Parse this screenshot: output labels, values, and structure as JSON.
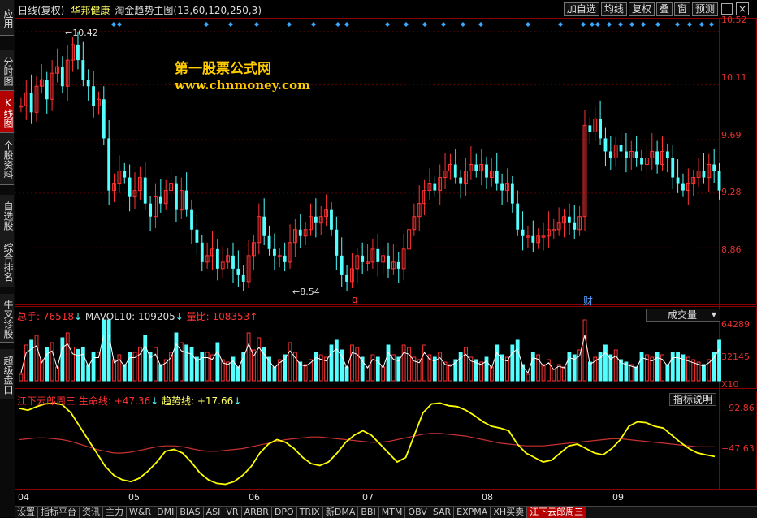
{
  "sidebar": {
    "tabs": [
      {
        "label": "应用",
        "active": false
      },
      {
        "label": "分时图",
        "active": false
      },
      {
        "label": "K线图",
        "active": true
      },
      {
        "label": "个股资料",
        "active": false
      },
      {
        "label": "自选股",
        "active": false
      },
      {
        "label": "综合排名",
        "active": false
      },
      {
        "label": "牛叉诊股",
        "active": false
      },
      {
        "label": "超级盘口",
        "active": false
      }
    ]
  },
  "header": {
    "period": "日线(复权)",
    "stock_name": "华邦健康",
    "indicator": "淘金趋势主图(13,60,120,250,3)",
    "buttons": [
      "加自选",
      "均线",
      "复权",
      "叠",
      "窗",
      "预测"
    ],
    "close_glyph": "×"
  },
  "watermark": {
    "line1": "第一股票公式网",
    "line2": "www.chnmoney.com"
  },
  "main_chart": {
    "price_scale": [
      "10.52",
      "10.11",
      "9.69",
      "9.28",
      "8.86"
    ],
    "high_label": "10.42",
    "low_label": "8.54",
    "markers": [
      "q",
      "财"
    ],
    "month_labels": [
      "04",
      "05",
      "06",
      "07",
      "08",
      "09"
    ]
  },
  "volume_panel": {
    "legend_total": "总手: 76518",
    "legend_mavol": "MAVOL10: 109205",
    "legend_ratio": "量比: 108353",
    "scale": [
      "64289",
      "32145",
      "X10"
    ],
    "dropdown_label": "成交量"
  },
  "indicator_panel": {
    "legend_name": "江下云郎周三",
    "legend_life": "生命线: +47.36",
    "legend_trend": "趋势线: +17.66",
    "scale": [
      "+92.86",
      "+47.63"
    ],
    "help_button": "指标说明"
  },
  "bottom_tabs": [
    "设置",
    "指标平台",
    "资讯",
    "主力",
    "W&R",
    "DMI",
    "BIAS",
    "ASI",
    "VR",
    "ARBR",
    "DPO",
    "TRIX",
    "新DMA",
    "BBI",
    "MTM",
    "OBV",
    "SAR",
    "EXPMA",
    "XH买卖",
    "江下云郎周三"
  ],
  "active_bottom_tab": "江下云郎周三",
  "colors": {
    "up": "#ff3232",
    "down": "#54ffff",
    "yellow": "#ffff00",
    "lifeline": "#c83232",
    "accent": "#b40000"
  },
  "chart_data": {
    "type": "candlestick",
    "price_axis": {
      "ticks": [
        10.52,
        10.11,
        9.69,
        9.28,
        8.86
      ],
      "range": [
        8.45,
        10.6
      ]
    },
    "high": 10.42,
    "low": 8.54,
    "candles_close": [
      9.95,
      10.05,
      9.9,
      10.1,
      10.15,
      10.0,
      10.2,
      10.25,
      10.1,
      10.3,
      10.42,
      10.3,
      10.15,
      10.1,
      9.95,
      10.0,
      9.7,
      9.3,
      9.35,
      9.45,
      9.4,
      9.25,
      9.3,
      9.4,
      9.2,
      9.1,
      9.25,
      9.2,
      9.3,
      9.35,
      9.15,
      9.3,
      9.15,
      9.0,
      8.9,
      8.75,
      8.8,
      8.85,
      8.7,
      8.75,
      8.8,
      8.7,
      8.65,
      8.6,
      8.8,
      8.9,
      9.1,
      8.95,
      8.85,
      8.8,
      8.8,
      8.75,
      8.9,
      9.0,
      8.95,
      9.0,
      9.1,
      9.05,
      9.1,
      9.15,
      9.0,
      8.8,
      8.65,
      8.6,
      8.7,
      8.8,
      8.75,
      8.75,
      8.85,
      8.75,
      8.8,
      8.7,
      8.75,
      8.7,
      8.85,
      9.0,
      9.1,
      9.2,
      9.3,
      9.35,
      9.3,
      9.4,
      9.45,
      9.5,
      9.4,
      9.35,
      9.45,
      9.5,
      9.45,
      9.5,
      9.4,
      9.45,
      9.35,
      9.3,
      9.35,
      9.2,
      9.0,
      8.95,
      8.95,
      8.9,
      8.95,
      8.95,
      9.0,
      9.0,
      9.05,
      9.1,
      9.05,
      9.0,
      9.1,
      9.8,
      9.75,
      9.85,
      9.7,
      9.6,
      9.55,
      9.65,
      9.6,
      9.55,
      9.6,
      9.55,
      9.5,
      9.55,
      9.6,
      9.5,
      9.6,
      9.55,
      9.4,
      9.35,
      9.3,
      9.35,
      9.4,
      9.45,
      9.4,
      9.5,
      9.45,
      9.3
    ],
    "volume_axis": {
      "ticks": [
        64289,
        32145
      ],
      "unit": "X10"
    },
    "indicator_axis": {
      "ticks": [
        92.86,
        47.63
      ]
    },
    "trend_line": [
      90,
      88,
      92,
      95,
      96,
      94,
      85,
      70,
      55,
      40,
      25,
      15,
      10,
      8,
      12,
      20,
      30,
      42,
      44,
      40,
      30,
      18,
      10,
      6,
      5,
      8,
      15,
      25,
      40,
      50,
      55,
      52,
      45,
      35,
      28,
      26,
      30,
      40,
      52,
      60,
      65,
      60,
      50,
      40,
      30,
      35,
      60,
      85,
      95,
      96,
      93,
      92,
      88,
      82,
      75,
      70,
      68,
      65,
      50,
      40,
      35,
      30,
      32,
      40,
      48,
      50,
      45,
      40,
      38,
      45,
      55,
      70,
      75,
      74,
      70,
      68,
      60,
      52,
      45,
      40,
      38,
      36
    ],
    "life_line": [
      55,
      56,
      57,
      57,
      56,
      55,
      53,
      50,
      47,
      44,
      42,
      40,
      40,
      41,
      43,
      45,
      47,
      48,
      48,
      47,
      45,
      43,
      42,
      42,
      43,
      44,
      45,
      47,
      49,
      51,
      53,
      55,
      56,
      57,
      58,
      58,
      57,
      56,
      55,
      54,
      53,
      52,
      52,
      53,
      55,
      57,
      59,
      61,
      62,
      62,
      61,
      60,
      59,
      57,
      55,
      53,
      51,
      50,
      49,
      48,
      48,
      48,
      49,
      50,
      51,
      52,
      53,
      54,
      55,
      56,
      56,
      55,
      54,
      53,
      52,
      51,
      50,
      49,
      48,
      47,
      47,
      47
    ]
  }
}
